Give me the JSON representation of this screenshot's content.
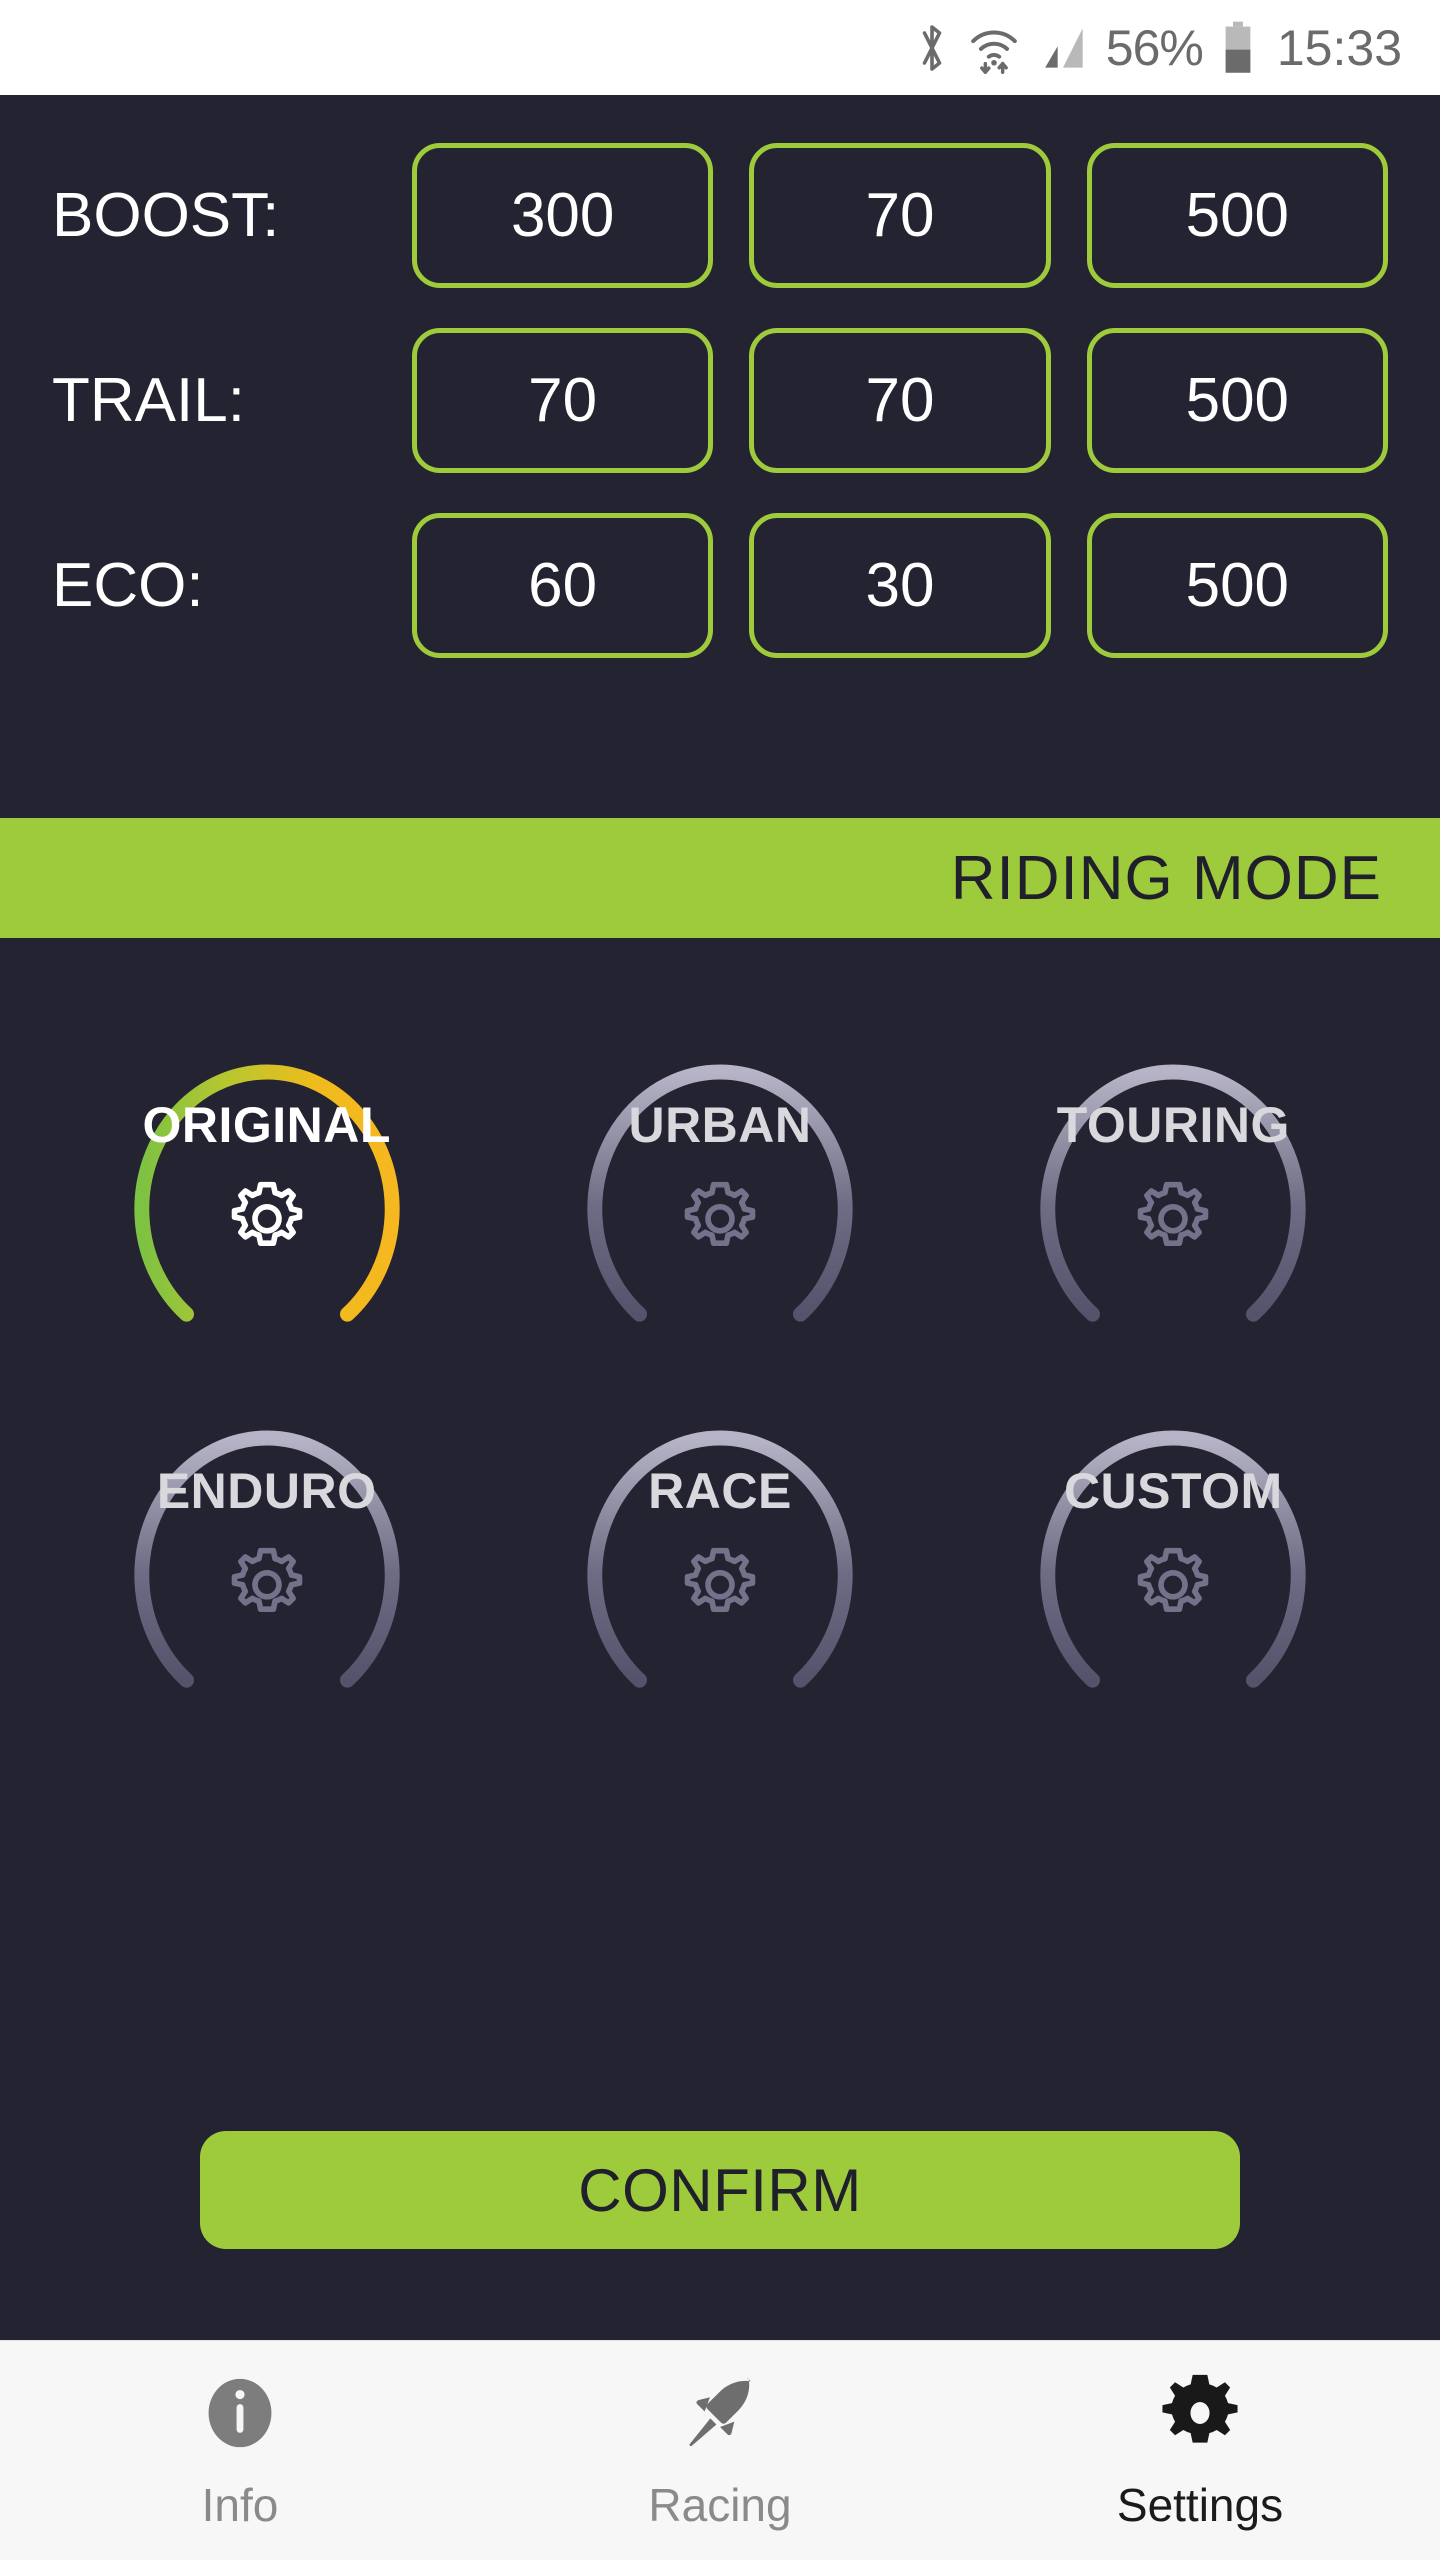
{
  "status_bar": {
    "bluetooth_icon": "bluetooth-icon",
    "wifi_icon": "wifi-icon",
    "signal_icon": "cellular-signal-icon",
    "battery_percent": "56%",
    "battery_icon": "battery-icon",
    "time": "15:33"
  },
  "params": {
    "rows": [
      {
        "label": "BOOST:",
        "values": [
          "300",
          "70",
          "500"
        ]
      },
      {
        "label": "TRAIL:",
        "values": [
          "70",
          "70",
          "500"
        ]
      },
      {
        "label": "ECO:",
        "values": [
          "60",
          "30",
          "500"
        ]
      }
    ]
  },
  "banner": {
    "title": "RIDING MODE"
  },
  "modes": {
    "items": [
      {
        "label": "ORIGINAL",
        "active": true
      },
      {
        "label": "URBAN",
        "active": false
      },
      {
        "label": "TOURING",
        "active": false
      },
      {
        "label": "ENDURO",
        "active": false
      },
      {
        "label": "RACE",
        "active": false
      },
      {
        "label": "CUSTOM",
        "active": false
      }
    ],
    "gear_icon": "gear-icon"
  },
  "confirm": {
    "label": "CONFIRM"
  },
  "bottom_nav": {
    "items": [
      {
        "label": "Info",
        "icon": "info-circle-icon",
        "active": false
      },
      {
        "label": "Racing",
        "icon": "rocket-icon",
        "active": false
      },
      {
        "label": "Settings",
        "icon": "gear-icon",
        "active": true
      }
    ]
  },
  "colors": {
    "background": "#242331",
    "accent_green": "#9ecb3c",
    "active_arc_start": "#7dc242",
    "active_arc_end": "#f5b820",
    "inactive_arc": "#6f6d85",
    "statusbar_bg": "#ffffff",
    "nav_bg": "#f7f7f8"
  }
}
